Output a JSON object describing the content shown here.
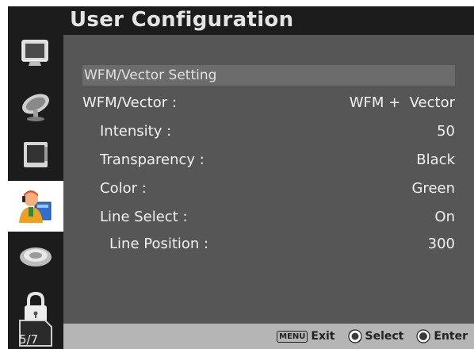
{
  "header": {
    "title": "User Configuration"
  },
  "sidebar": {
    "items": [
      {
        "icon": "monitor-icon"
      },
      {
        "icon": "satellite-dish-icon"
      },
      {
        "icon": "display-panel-icon"
      },
      {
        "icon": "user-config-icon",
        "active": true
      },
      {
        "icon": "dial-icon"
      },
      {
        "icon": "lock-icon"
      }
    ],
    "page_indicator": "5/7"
  },
  "main": {
    "section_title": "WFM/Vector Setting",
    "rows": [
      {
        "label": "WFM/Vector :",
        "value": "WFM +  Vector"
      },
      {
        "label": "Intensity :",
        "value": "50"
      },
      {
        "label": "Transparency :",
        "value": "Black"
      },
      {
        "label": "Color :",
        "value": "Green"
      },
      {
        "label": "Line Select :",
        "value": "On"
      },
      {
        "label": "Line Position :",
        "value": "300"
      }
    ]
  },
  "footer": {
    "menu_key": "MENU",
    "exit_label": "Exit",
    "select_label": "Select",
    "enter_label": "Enter"
  },
  "colors": {
    "panel": "#565656",
    "sidebar": "#1c1c1c",
    "footer": "#b5b5b5",
    "text": "#f0f0f0"
  }
}
